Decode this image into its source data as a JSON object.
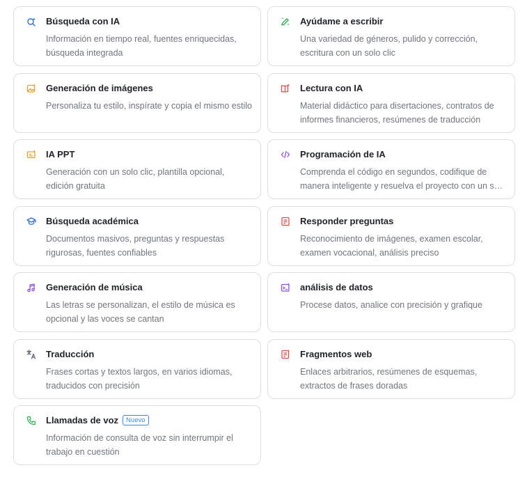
{
  "cards": [
    {
      "title": "Búsqueda con IA",
      "desc": "Información en tiempo real, fuentes enriquecidas, búsqueda integrada",
      "icon": "ai-search-icon",
      "color": "#2f6fd6"
    },
    {
      "title": "Ayúdame a escribir",
      "desc": "Una variedad de géneros, pulido y corrección, escritura con un solo clic",
      "icon": "pencil-sparkle-icon",
      "color": "#2fae52"
    },
    {
      "title": "Generación de imágenes",
      "desc": "Personaliza tu estilo, inspírate y copia el mismo estilo",
      "icon": "image-sparkle-icon",
      "color": "#e9a020"
    },
    {
      "title": "Lectura con IA",
      "desc": "Material didáctico para disertaciones, contratos de informes financieros, resúmenes de traducción",
      "icon": "book-sparkle-icon",
      "color": "#e24a4a"
    },
    {
      "title": "IA PPT",
      "desc": "Generación con un solo clic, plantilla opcional, edición gratuita",
      "icon": "presentation-icon",
      "color": "#e9a020"
    },
    {
      "title": "Programación de IA",
      "desc": "Comprenda el código en segundos, codifique de manera inteligente y resuelva el proyecto con un solo clic",
      "icon": "code-icon",
      "color": "#8a4fe0"
    },
    {
      "title": "Búsqueda académica",
      "desc": "Documentos masivos, preguntas y respuestas rigurosas, fuentes confiables",
      "icon": "graduation-cap-icon",
      "color": "#2f6fd6"
    },
    {
      "title": "Responder preguntas",
      "desc": "Reconocimiento de imágenes, examen escolar, examen vocacional, análisis preciso",
      "icon": "question-doc-icon",
      "color": "#e24a4a"
    },
    {
      "title": "Generación de música",
      "desc": "Las letras se personalizan, el estilo de música es opcional y las voces se cantan",
      "icon": "music-note-icon",
      "color": "#8a4fe0"
    },
    {
      "title": "análisis de datos",
      "desc": "Procese datos, analice con precisión y grafique",
      "icon": "data-terminal-icon",
      "color": "#8a4fe0"
    },
    {
      "title": "Traducción",
      "desc": "Frases cortas y textos largos, en varios idiomas, traducidos con precisión",
      "icon": "translate-icon",
      "color": "#5a6270"
    },
    {
      "title": "Fragmentos web",
      "desc": "Enlaces arbitrarios, resúmenes de esquemas, extractos de frases doradas",
      "icon": "web-clip-icon",
      "color": "#e24a4a"
    },
    {
      "title": "Llamadas de voz",
      "desc": "Información de consulta de voz sin interrumpir el trabajo en cuestión",
      "icon": "phone-icon",
      "color": "#2fae52",
      "badge": "Nuevo"
    }
  ]
}
